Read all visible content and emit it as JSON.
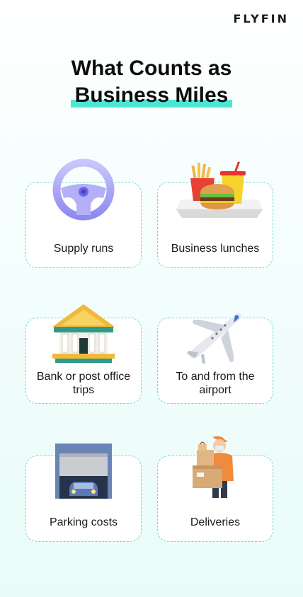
{
  "brand": {
    "logo": "FLYFIN"
  },
  "title": {
    "line1": "What Counts as",
    "line2": "Business Miles"
  },
  "colors": {
    "accent": "#4de6d3",
    "border": "#6ed9cc"
  },
  "cards": [
    {
      "label": "Supply runs",
      "icon": "steering-wheel-icon"
    },
    {
      "label": "Business lunches",
      "icon": "burger-meal-icon"
    },
    {
      "label": "Bank or post office trips",
      "icon": "bank-building-icon"
    },
    {
      "label": "To and from the airport",
      "icon": "airplane-icon"
    },
    {
      "label": "Parking costs",
      "icon": "parking-garage-icon"
    },
    {
      "label": "Deliveries",
      "icon": "delivery-person-icon"
    }
  ]
}
